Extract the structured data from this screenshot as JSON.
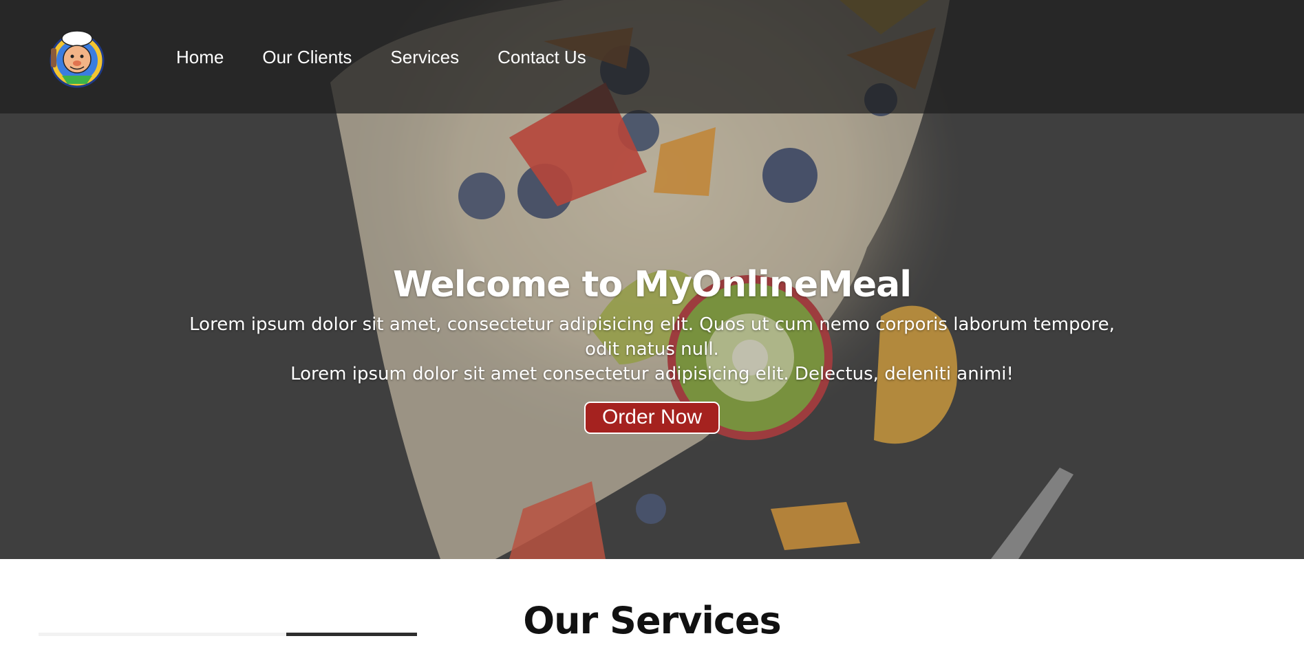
{
  "brand": {
    "logo_icon": "chef-mascot-icon"
  },
  "nav": {
    "items": [
      {
        "label": "Home"
      },
      {
        "label": "Our Clients"
      },
      {
        "label": "Services"
      },
      {
        "label": "Contact Us"
      }
    ]
  },
  "hero": {
    "title": "Welcome to MyOnlineMeal",
    "text_line1": "Lorem ipsum dolor sit amet, consectetur adipisicing elit. Quos ut cum nemo corporis laborum tempore, odit natus null.",
    "text_line2": "Lorem ipsum dolor sit amet consectetur adipisicing elit. Delectus, deleniti animi!",
    "cta_label": "Order Now"
  },
  "services": {
    "title": "Our Services"
  },
  "colors": {
    "nav_bg": "#1e1e1e",
    "cta_bg": "#a5221f",
    "hero_bg": "#3e3e3e"
  }
}
